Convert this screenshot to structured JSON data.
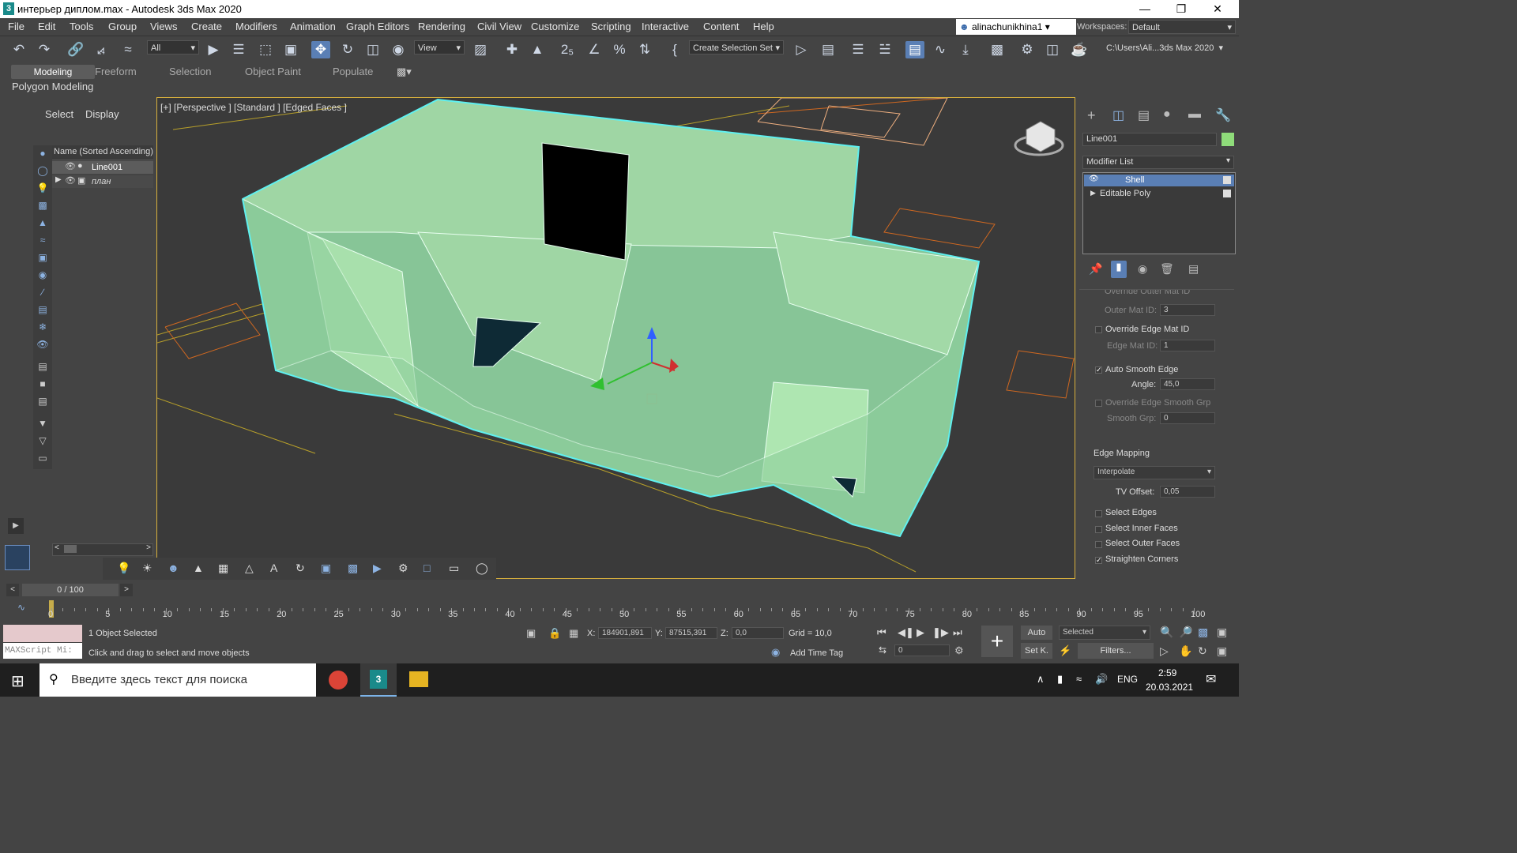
{
  "window": {
    "title": "интерьер диплом.max - Autodesk 3ds Max 2020",
    "app_icon": "3"
  },
  "menu": [
    "File",
    "Edit",
    "Tools",
    "Group",
    "Views",
    "Create",
    "Modifiers",
    "Animation",
    "Graph Editors",
    "Rendering",
    "Civil View",
    "Customize",
    "Scripting",
    "Interactive",
    "Content",
    "Help"
  ],
  "user": "alinachunikhina1",
  "workspaces": {
    "label": "Workspaces:",
    "value": "Default"
  },
  "toolbar": {
    "filter_value": "All",
    "ref_coord_value": "View",
    "selection_set": "Create Selection Set",
    "project_path": "C:\\Users\\Ali...3ds Max 2020"
  },
  "ribbon": {
    "tabs": [
      "Modeling",
      "Freeform",
      "Selection",
      "Object Paint",
      "Populate"
    ],
    "panel_label": "Polygon Modeling"
  },
  "explorer": {
    "tabs": [
      "Select",
      "Display"
    ],
    "column_header": "Name (Sorted Ascending)",
    "items": [
      "Line001",
      "план"
    ]
  },
  "viewport": {
    "label": "[+] [Perspective ] [Standard ] [Edged Faces ]"
  },
  "command_panel": {
    "object_name": "Line001",
    "modifier_list_label": "Modifier List",
    "stack": [
      "Shell",
      "Editable Poly"
    ],
    "truncated_top": "Override Outer Mat ID",
    "outer_mat_id": {
      "label": "Outer Mat ID:",
      "value": "3"
    },
    "override_edge_mat_id": "Override Edge Mat ID",
    "edge_mat_id": {
      "label": "Edge Mat ID:",
      "value": "1"
    },
    "auto_smooth_edge": "Auto Smooth Edge",
    "angle": {
      "label": "Angle:",
      "value": "45,0"
    },
    "override_edge_smooth_grp": "Override Edge Smooth Grp",
    "smooth_grp": {
      "label": "Smooth Grp:",
      "value": "0"
    },
    "edge_mapping_label": "Edge Mapping",
    "edge_mapping_value": "Interpolate",
    "tv_offset": {
      "label": "TV Offset:",
      "value": "0,05"
    },
    "select_edges": "Select Edges",
    "select_inner_faces": "Select Inner Faces",
    "select_outer_faces": "Select Outer Faces",
    "straighten_corners": "Straighten Corners"
  },
  "timeline": {
    "frame_counter": "0 / 100",
    "ticks": [
      "0",
      "5",
      "10",
      "15",
      "20",
      "25",
      "30",
      "35",
      "40",
      "45",
      "50",
      "55",
      "60",
      "65",
      "70",
      "75",
      "80",
      "85",
      "90",
      "95",
      "100"
    ]
  },
  "status": {
    "maxscript": "MAXScript Mi:",
    "selected_count": "1 Object Selected",
    "prompt": "Click and drag to select and move objects",
    "x_label": "X:",
    "x_value": "184901,891",
    "y_label": "Y:",
    "y_value": "87515,391",
    "z_label": "Z:",
    "z_value": "0,0",
    "grid": "Grid = 10,0",
    "add_time_tag": "Add Time Tag",
    "auto": "Auto",
    "selected_dropdown": "Selected",
    "set_key": "Set K.",
    "filters": "Filters...",
    "frame_value": "0"
  },
  "taskbar": {
    "search_placeholder": "Введите здесь текст для поиска",
    "lang": "ENG",
    "time": "2:59",
    "date": "20.03.2021"
  },
  "colors": {
    "accent": "#5a7fb5",
    "mesh": "#9fd6a4",
    "selection": "#5ff0f0",
    "viewport_border": "#d9b13d"
  }
}
